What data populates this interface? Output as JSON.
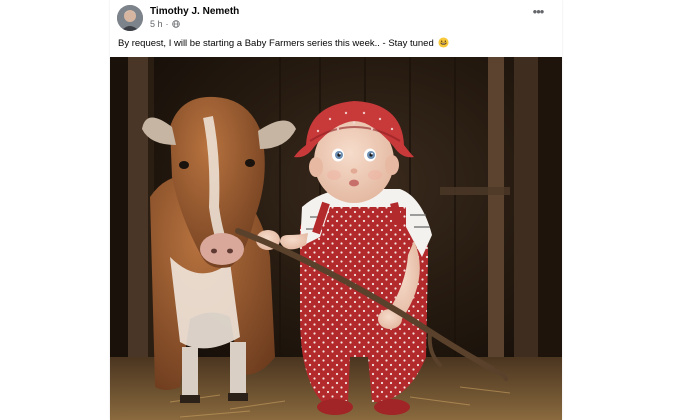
{
  "post": {
    "author": "Timothy J. Nemeth",
    "time": "5 h",
    "separator": "·",
    "privacy_icon": "globe-icon",
    "more_icon": "more-options-icon",
    "more_glyph": "•••",
    "text": "By request, I will be starting a Baby Farmers series this week..  - Stay tuned",
    "emoji_icon": "grin-emoji-icon"
  },
  "image": {
    "subject": "baby-in-red-overalls-with-cow-in-barn"
  },
  "colors": {
    "author_text": "#050505",
    "meta_text": "#65676b",
    "overalls_red": "#b32a2d",
    "hat_red": "#c8393a",
    "cow_brown": "#9b5a33"
  }
}
